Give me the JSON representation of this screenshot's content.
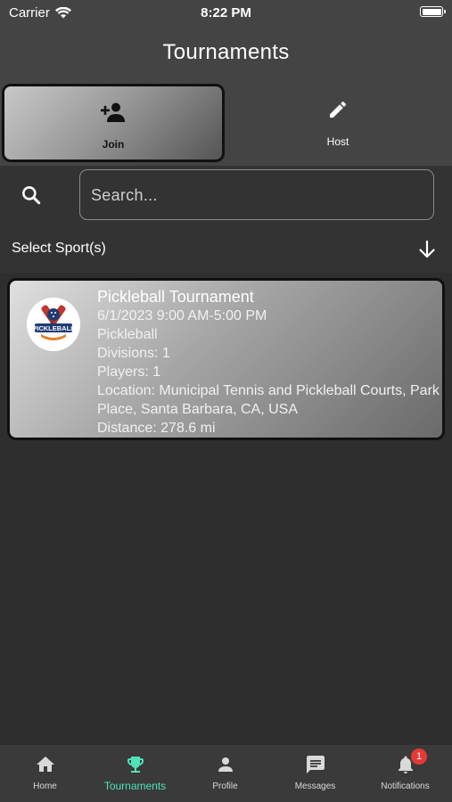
{
  "status_bar": {
    "carrier": "Carrier",
    "time": "8:22 PM"
  },
  "header": {
    "title": "Tournaments"
  },
  "tabs": [
    {
      "label": "Join",
      "icon": "person-add-icon",
      "selected": true
    },
    {
      "label": "Host",
      "icon": "pencil-icon",
      "selected": false
    }
  ],
  "search": {
    "placeholder": "Search..."
  },
  "sport_filter": {
    "label": "Select Sport(s)"
  },
  "tournaments": [
    {
      "title": "Pickleball Tournament",
      "date": "6/1/2023 9:00 AM-5:00 PM",
      "sport": "Pickleball",
      "divisions": "Divisions: 1",
      "players": "Players: 1",
      "location": "Location: Municipal Tennis and Pickleball Courts, Park Place, Santa Barbara, CA, USA",
      "distance": "Distance: 278.6 mi",
      "logo_text": "PICKLEBALL"
    }
  ],
  "bottom_nav": {
    "active_color": "#4fe3b8",
    "items": [
      {
        "label": "Home",
        "icon": "home-icon"
      },
      {
        "label": "Tournaments",
        "icon": "trophy-icon",
        "active": true
      },
      {
        "label": "Profile",
        "icon": "person-icon"
      },
      {
        "label": "Messages",
        "icon": "message-icon"
      },
      {
        "label": "Notifications",
        "icon": "bell-icon",
        "badge": "1"
      }
    ]
  }
}
